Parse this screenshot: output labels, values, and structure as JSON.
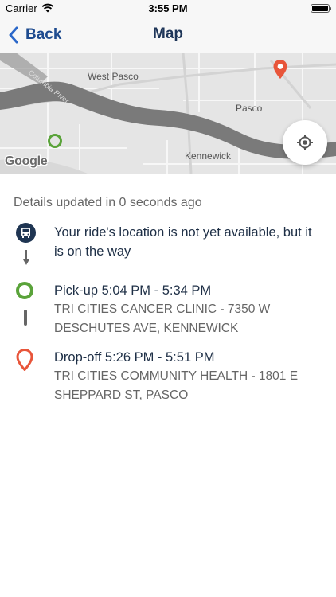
{
  "status_bar": {
    "carrier": "Carrier",
    "time": "3:55 PM"
  },
  "nav": {
    "back_label": "Back",
    "title": "Map"
  },
  "map": {
    "labels": {
      "west_pasco": "West Pasco",
      "pasco": "Pasco",
      "kennewick": "Kennewick",
      "river": "Columbia River"
    },
    "attribution": "Google"
  },
  "details": {
    "updated_text": "Details updated in 0 seconds ago",
    "vehicle": {
      "status": "Your ride's location is not yet available, but it is on the way"
    },
    "pickup": {
      "label": "Pick-up 5:04 PM - 5:34 PM",
      "address": "TRI CITIES CANCER CLINIC - 7350 W DESCHUTES AVE, KENNEWICK"
    },
    "dropoff": {
      "label": "Drop-off 5:26 PM - 5:51 PM",
      "address": "TRI CITIES COMMUNITY HEALTH - 1801 E SHEPPARD ST, PASCO"
    }
  },
  "colors": {
    "accent": "#1e4b8f",
    "pickup_green": "#5aa33a",
    "dropoff_orange": "#e8553a",
    "bus_navy": "#1f3552"
  }
}
